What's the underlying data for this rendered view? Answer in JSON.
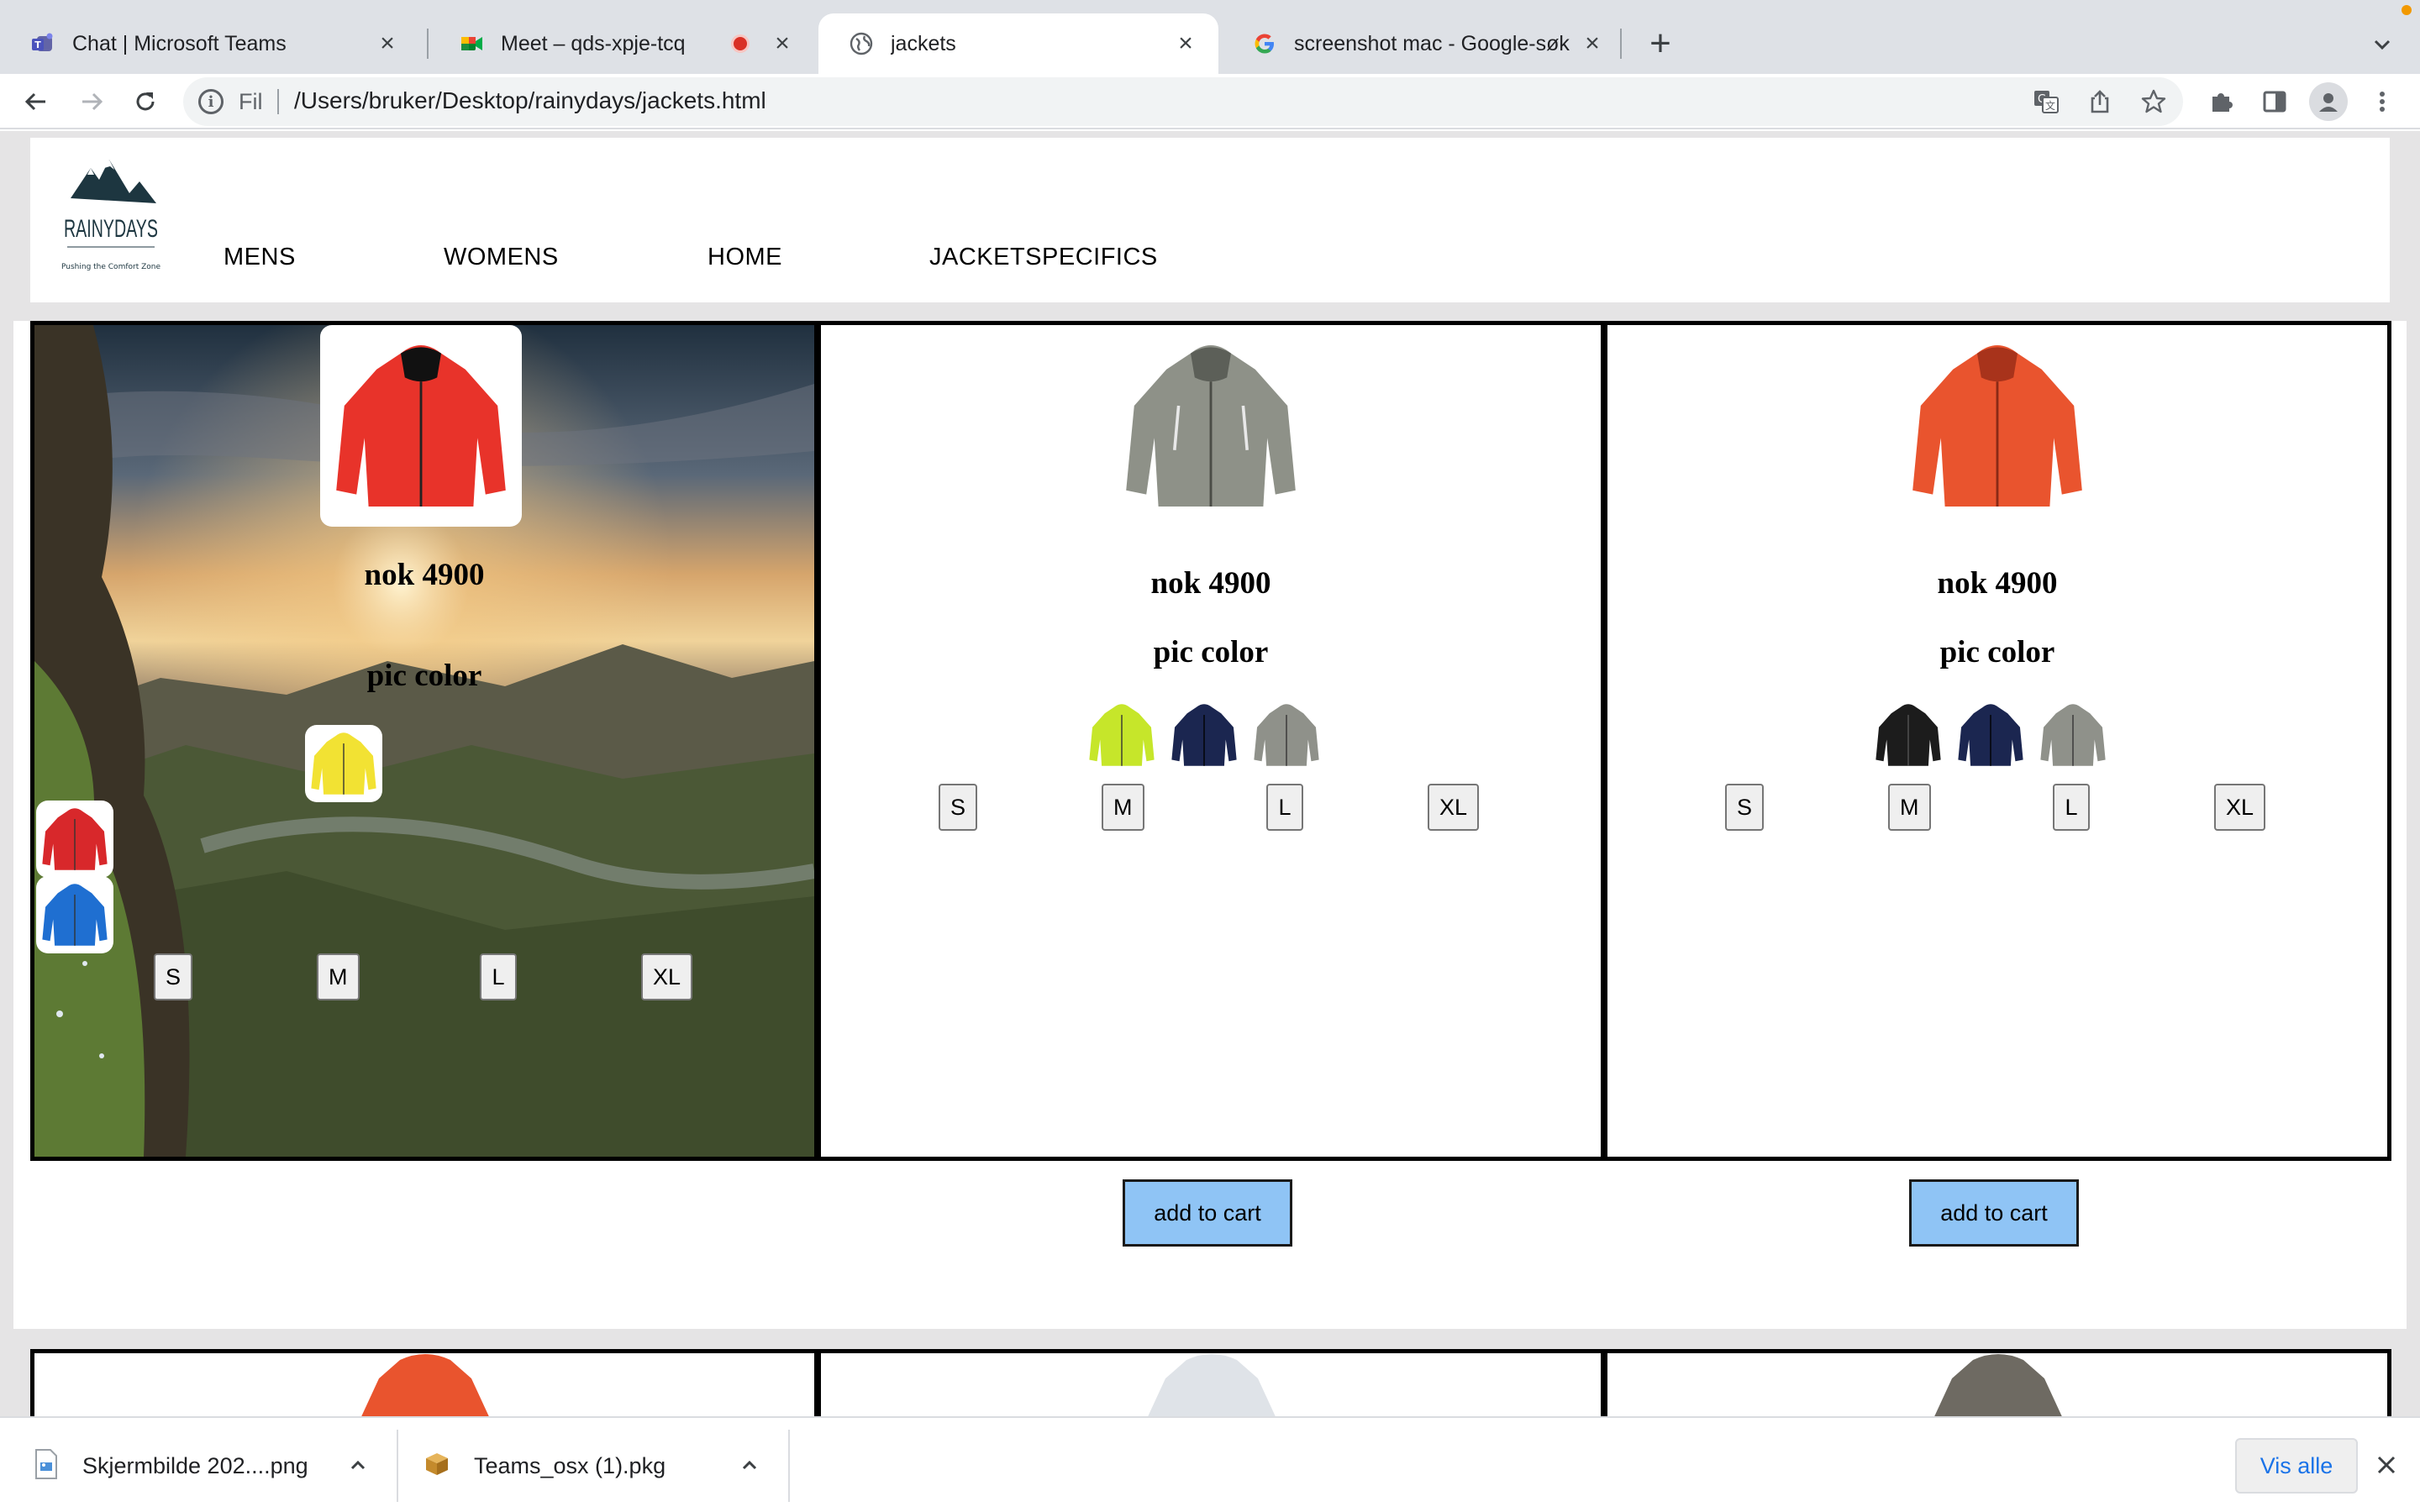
{
  "browser": {
    "tabs": [
      {
        "title": "Chat | Microsoft Teams",
        "icon": "teams-icon"
      },
      {
        "title": "Meet – qds-xpje-tcq",
        "icon": "meet-icon",
        "recording": true
      },
      {
        "title": "jackets",
        "icon": "globe-icon",
        "active": true
      },
      {
        "title": "screenshot mac - Google-søk",
        "icon": "google-icon"
      }
    ],
    "new_tab": "+",
    "address_bar": {
      "scheme_label": "Fil",
      "url": "/Users/bruker/Desktop/rainydays/jackets.html"
    }
  },
  "site": {
    "logo": {
      "name": "RAINYDAYS",
      "tagline": "A Pushing the Comfort Zone A"
    },
    "nav": [
      "MENS",
      "WOMENS",
      "HOME",
      "JACKETSPECIFICS"
    ]
  },
  "products": [
    {
      "price": "nok 4900",
      "pick_label": "pic color",
      "jacket_color": "#e8332a",
      "swatches": [
        {
          "name": "yellow-jacket",
          "color": "#f2e233"
        },
        {
          "name": "red-jacket",
          "color": "#d8282b"
        },
        {
          "name": "blue-jacket",
          "color": "#1f6fd1"
        }
      ],
      "sizes": [
        "S",
        "M",
        "L",
        "XL"
      ]
    },
    {
      "price": "nok 4900",
      "pick_label": "pic color",
      "jacket_color": "#8e9188",
      "swatches": [
        {
          "name": "lime-jacket",
          "color": "#c6e62a"
        },
        {
          "name": "navy-jacket",
          "color": "#1b2650"
        },
        {
          "name": "grey-jacket",
          "color": "#8f918a"
        }
      ],
      "sizes": [
        "S",
        "M",
        "L",
        "XL"
      ],
      "cart_label": "add to cart"
    },
    {
      "price": "nok 4900",
      "pick_label": "pic color",
      "jacket_color": "#e9542e",
      "swatches": [
        {
          "name": "black-jacket",
          "color": "#1c1c1c"
        },
        {
          "name": "navy-jacket",
          "color": "#1b2650"
        },
        {
          "name": "grey-jacket",
          "color": "#8f918a"
        }
      ],
      "sizes": [
        "S",
        "M",
        "L",
        "XL"
      ],
      "cart_label": "add to cart"
    }
  ],
  "row2_colors": [
    "#e9542e",
    "#dfe3e8",
    "#6e6a62"
  ],
  "downloads": {
    "items": [
      {
        "name": "Skjermbilde 202....png",
        "icon": "image-file-icon"
      },
      {
        "name": "Teams_osx (1).pkg",
        "icon": "package-file-icon"
      }
    ],
    "show_all": "Vis alle"
  },
  "colors": {
    "accent": "#8fc4f5",
    "link": "#1a73e8",
    "recording": "#d93025"
  }
}
